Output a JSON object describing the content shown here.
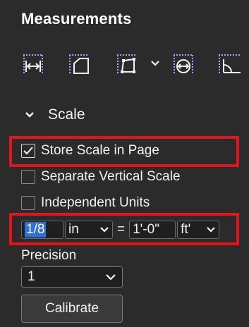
{
  "panel": {
    "title": "Measurements"
  },
  "toolbar": {
    "tools": [
      {
        "icon": "distance-measure-icon"
      },
      {
        "icon": "perimeter-measure-icon"
      },
      {
        "icon": "area-measure-icon",
        "has_dropdown": true
      },
      {
        "icon": "diameter-measure-icon"
      },
      {
        "icon": "angle-measure-icon"
      }
    ]
  },
  "scale_section": {
    "label": "Scale",
    "store_scale": {
      "label": "Store Scale in Page",
      "checked": true
    },
    "separate_vertical": {
      "label": "Separate Vertical Scale",
      "checked": false
    },
    "independent_units": {
      "label": "Independent Units",
      "checked": false
    },
    "document_value": "1/8",
    "document_unit": "in",
    "equals": "=",
    "page_value": "1'-0\"",
    "page_unit": "ft'"
  },
  "precision": {
    "label": "Precision",
    "value": "1"
  },
  "calibrate_button": {
    "label": "Calibrate"
  },
  "highlight_color": "#e3151a"
}
